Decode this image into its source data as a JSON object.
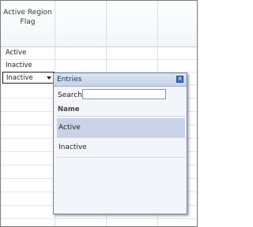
{
  "grid": {
    "header": "Active Region Flag",
    "rows": [
      "Active",
      "Inactive"
    ],
    "editor_value": "Inactive"
  },
  "popup": {
    "title": "Entries",
    "search_label": "Search",
    "search_value": "",
    "column_header": "Name",
    "entries": [
      "Active",
      "Inactive"
    ],
    "selected_entry": "Active"
  },
  "icons": {
    "close": "close-icon",
    "dropdown": "chevron-down-icon"
  }
}
